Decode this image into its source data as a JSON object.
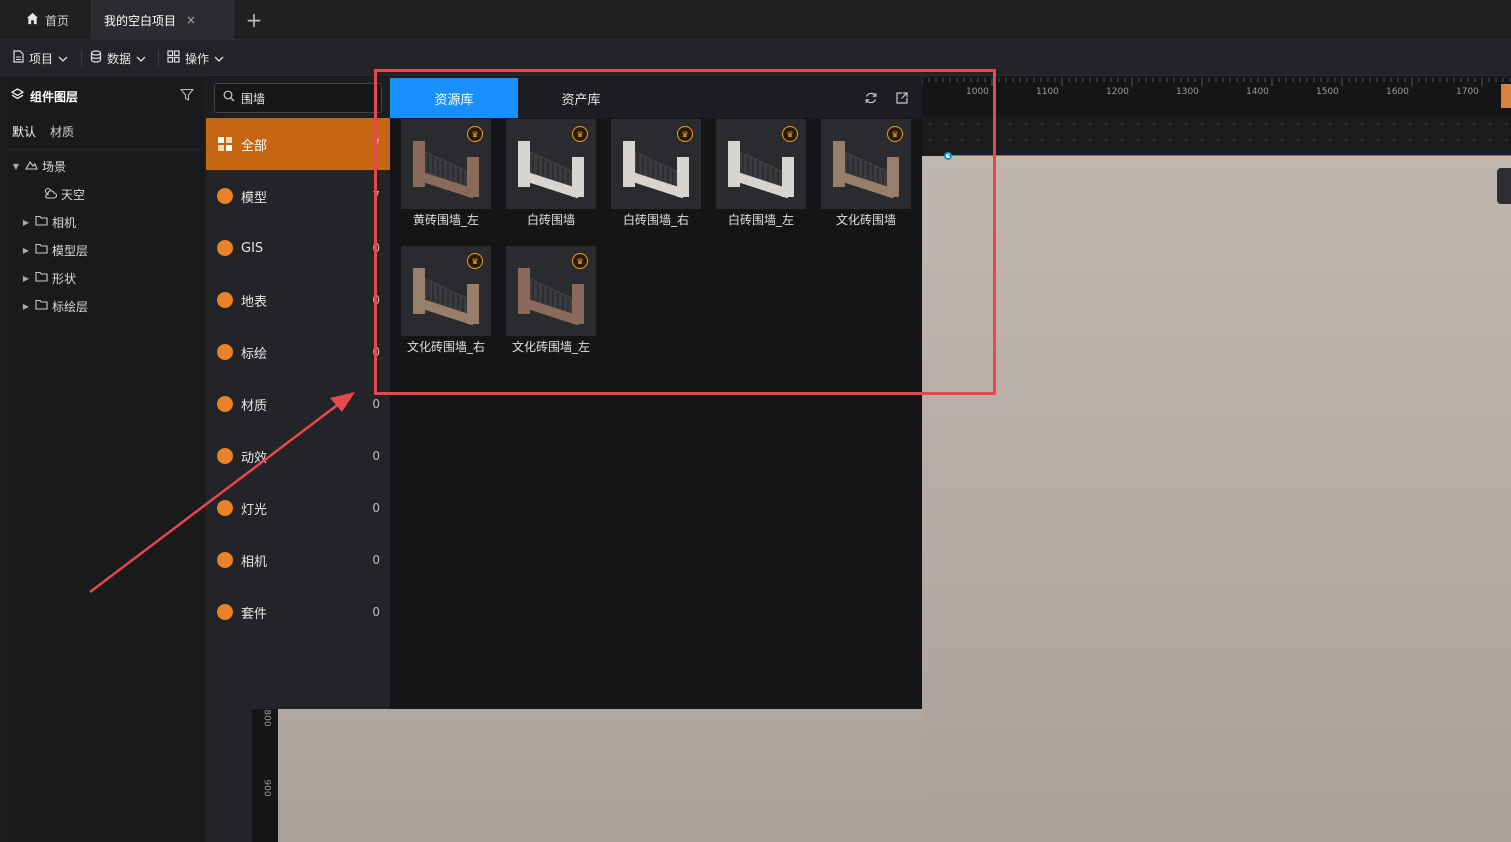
{
  "tabs": [
    {
      "label": "首页",
      "icon": "home-icon"
    },
    {
      "label": "我的空白项目",
      "close": "×"
    }
  ],
  "add_tab": "+",
  "menus": [
    {
      "label": "项目",
      "icon": "file-icon"
    },
    {
      "label": "数据",
      "icon": "database-icon"
    },
    {
      "label": "操作",
      "icon": "grid-icon"
    }
  ],
  "layers": {
    "title": "组件图层",
    "subtabs": [
      "默认",
      "材质"
    ],
    "tree": [
      {
        "label": "场景",
        "icon": "scene-icon",
        "caret": "▼"
      },
      {
        "label": "天空",
        "icon": "weather-icon",
        "caret": ""
      },
      {
        "label": "相机",
        "icon": "folder-icon",
        "caret": "▶"
      },
      {
        "label": "模型层",
        "icon": "folder-icon",
        "caret": "▶"
      },
      {
        "label": "形状",
        "icon": "folder-icon",
        "caret": "▶"
      },
      {
        "label": "标绘层",
        "icon": "folder-icon",
        "caret": "▶"
      }
    ]
  },
  "search": {
    "value": "围墙",
    "placeholder": "搜索"
  },
  "categories": [
    {
      "label": "全部",
      "count": "7",
      "icon": "grid-icon",
      "active": true
    },
    {
      "label": "模型",
      "count": "7",
      "icon": "cube-icon"
    },
    {
      "label": "GIS",
      "count": "0",
      "icon": "globe-icon"
    },
    {
      "label": "地表",
      "count": "0",
      "icon": "terrain-icon"
    },
    {
      "label": "标绘",
      "count": "0",
      "icon": "pin-icon"
    },
    {
      "label": "材质",
      "count": "0",
      "icon": "material-icon"
    },
    {
      "label": "动效",
      "count": "0",
      "icon": "effect-icon"
    },
    {
      "label": "灯光",
      "count": "0",
      "icon": "light-icon"
    },
    {
      "label": "相机",
      "count": "0",
      "icon": "camera-icon"
    },
    {
      "label": "套件",
      "count": "0",
      "icon": "kit-icon"
    }
  ],
  "library": {
    "tabs": [
      "资源库",
      "资产库"
    ],
    "items": [
      {
        "name": "黄砖围墙_左",
        "color": "#8a6a5a"
      },
      {
        "name": "白砖围墙",
        "color": "#d8d4cf"
      },
      {
        "name": "白砖围墙_右",
        "color": "#d8d4cf"
      },
      {
        "name": "白砖围墙_左",
        "color": "#d8d4cf"
      },
      {
        "name": "文化砖围墙",
        "color": "#9a7e6c"
      },
      {
        "name": "文化砖围墙_右",
        "color": "#9a7e6c"
      },
      {
        "name": "文化砖围墙_左",
        "color": "#8a6a5a"
      }
    ]
  },
  "ruler": {
    "top": [
      "1000",
      "1100",
      "1200",
      "1300",
      "1400",
      "1500",
      "1600",
      "1700"
    ],
    "left": [
      "800",
      "900"
    ]
  },
  "annotation": {
    "box_color": "#e8474b",
    "arrow_color": "#e8474b"
  }
}
